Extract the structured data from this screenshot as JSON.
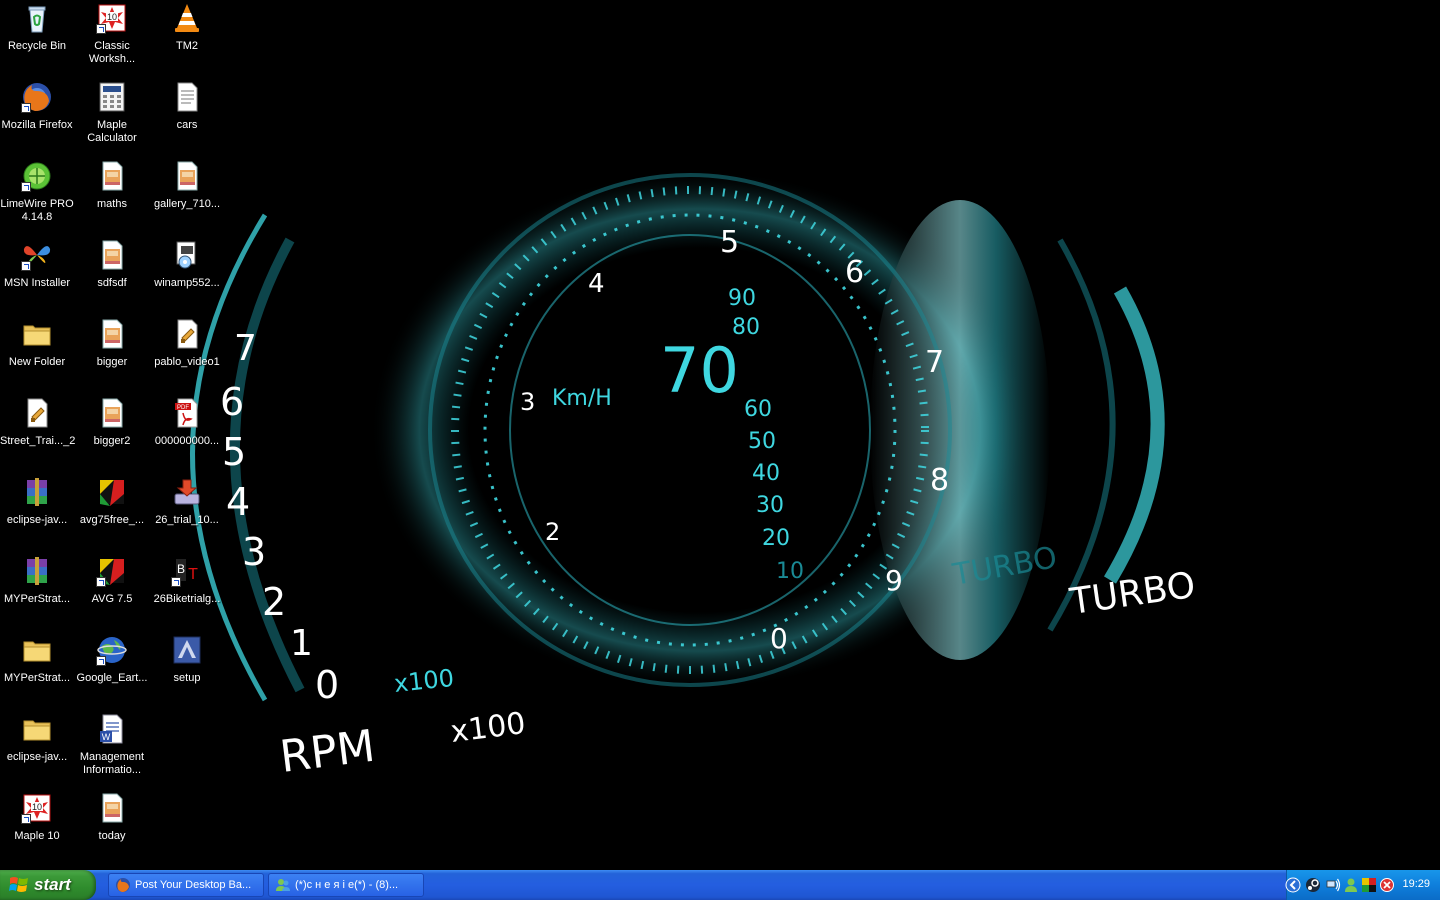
{
  "wallpaper": {
    "speed": "70",
    "unit": "Km/H",
    "speed_scale": [
      "90",
      "80",
      "60",
      "50",
      "40",
      "30",
      "20",
      "10"
    ],
    "rpm_label": "RPM",
    "rpm_mult": "x100",
    "rpm_scale": [
      "7",
      "6",
      "5",
      "4",
      "3",
      "2",
      "1",
      "0"
    ],
    "dial_numbers": [
      "2",
      "3",
      "4",
      "5",
      "6",
      "7",
      "8",
      "9",
      "0"
    ],
    "turbo": "TURBO",
    "turbo_ghost": "TURBO",
    "x100_small": "x100",
    "colors": {
      "accent": "#3fd7e0",
      "glow": "#9ff4f8"
    }
  },
  "desktop": {
    "icons": [
      {
        "label": "Recycle Bin",
        "icon": "recycle-bin-icon"
      },
      {
        "label": "Classic Worksh...",
        "icon": "maple-icon"
      },
      {
        "label": "TM2",
        "icon": "vlc-cone-icon"
      },
      {
        "label": "Mozilla Firefox",
        "icon": "firefox-icon"
      },
      {
        "label": "Maple Calculator",
        "icon": "calculator-icon"
      },
      {
        "label": "cars",
        "icon": "text-file-icon"
      },
      {
        "label": "LimeWire PRO 4.14.8",
        "icon": "limewire-icon"
      },
      {
        "label": "maths",
        "icon": "document-icon"
      },
      {
        "label": "gallery_710...",
        "icon": "document-icon"
      },
      {
        "label": "MSN Installer",
        "icon": "msn-butterfly-icon"
      },
      {
        "label": "sdfsdf",
        "icon": "document-icon"
      },
      {
        "label": "winamp552...",
        "icon": "installer-icon"
      },
      {
        "label": "New Folder",
        "icon": "folder-icon"
      },
      {
        "label": "bigger",
        "icon": "document-icon"
      },
      {
        "label": "pablo_video1",
        "icon": "video-file-icon"
      },
      {
        "label": "Street_Trai..._2",
        "icon": "video-file-icon"
      },
      {
        "label": "bigger2",
        "icon": "document-icon"
      },
      {
        "label": "000000000...",
        "icon": "pdf-icon"
      },
      {
        "label": "eclipse-jav...",
        "icon": "winrar-icon"
      },
      {
        "label": "avg75free_...",
        "icon": "avg-icon"
      },
      {
        "label": "26_trial_10...",
        "icon": "download-installer-icon"
      },
      {
        "label": "MYPerStrat...",
        "icon": "winrar-icon"
      },
      {
        "label": "AVG 7.5",
        "icon": "avg-icon"
      },
      {
        "label": "26Biketrialg...",
        "icon": "game-icon"
      },
      {
        "label": "MYPerStrat...",
        "icon": "folder-icon"
      },
      {
        "label": "Google_Eart...",
        "icon": "google-earth-icon"
      },
      {
        "label": "setup",
        "icon": "setup-icon"
      },
      {
        "label": "eclipse-jav...",
        "icon": "folder-icon"
      },
      {
        "label": "Management Informatio...",
        "icon": "word-doc-icon"
      },
      {
        "label": "Maple 10",
        "icon": "maple-icon"
      },
      {
        "label": "today",
        "icon": "document-icon"
      }
    ]
  },
  "taskbar": {
    "start_label": "start",
    "tasks": [
      {
        "label": "Post Your Desktop Ba...",
        "icon": "firefox-icon"
      },
      {
        "label": "(*)с н е я і е(*) - (8)...",
        "icon": "msn-icon"
      }
    ],
    "tray_icons": [
      "chevron-left-icon",
      "steam-icon",
      "network-icon",
      "msn-buddy-icon",
      "avg-tray-icon",
      "security-icon"
    ],
    "clock": "19:29"
  }
}
